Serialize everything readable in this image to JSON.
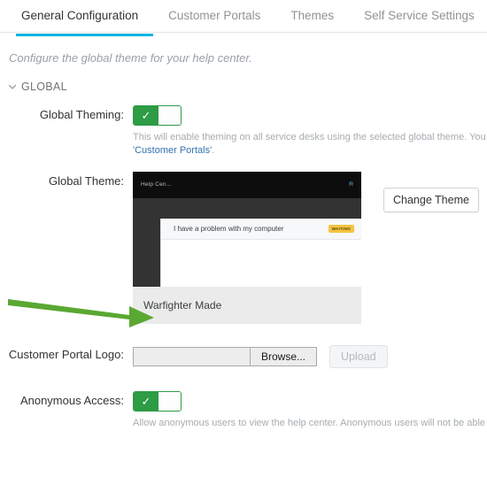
{
  "tabs": [
    {
      "label": "General Configuration",
      "active": true
    },
    {
      "label": "Customer Portals",
      "active": false
    },
    {
      "label": "Themes",
      "active": false
    },
    {
      "label": "Self Service Settings",
      "active": false
    }
  ],
  "page": {
    "description": "Configure the global theme for your help center.",
    "accent_color": "#00b5e2"
  },
  "section": {
    "title": "GLOBAL",
    "chevron_icon": "chevron-down-icon",
    "expanded": true
  },
  "global_theming": {
    "label": "Global Theming:",
    "toggle_state": "on",
    "toggle_check_glyph": "✓",
    "toggle_on_color": "#2e9b45",
    "help_line1": "This will enable theming on all service desks using the selected global theme. You can still the",
    "help_link": "'Customer Portals'",
    "help_link_color": "#3572b0",
    "help_line2_suffix": "."
  },
  "global_theme": {
    "label": "Global Theme:",
    "change_button": "Change Theme",
    "preview": {
      "topbar_logo": "Help Cen...",
      "topbar_right": "R",
      "request_title": "I have a problem with my computer",
      "status_badge": "WAITING",
      "status_badge_color": "#f6c342",
      "footer_title": "Warfighter Made",
      "background_color": "#333333",
      "topbar_color": "#0d0d0d",
      "footer_color": "#ebebeb"
    }
  },
  "annotation": {
    "arrow_icon": "green-arrow-right-icon",
    "arrow_color": "#5aa832",
    "points_at": "Warfighter Made"
  },
  "customer_portal_logo": {
    "label": "Customer Portal Logo:",
    "file_value": "",
    "browse_button": "Browse...",
    "upload_button": "Upload",
    "upload_disabled": true
  },
  "anonymous_access": {
    "label": "Anonymous Access:",
    "toggle_state": "on",
    "toggle_check_glyph": "✓",
    "help_text": "Allow anonymous users to view the help center. Anonymous users will not be able to add requ"
  }
}
